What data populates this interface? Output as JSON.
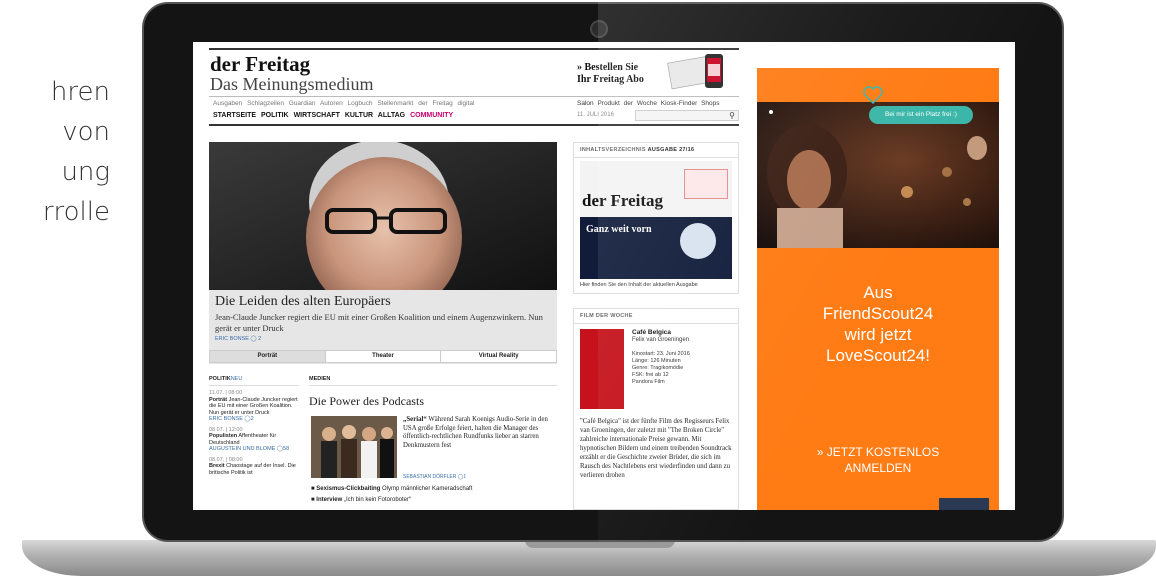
{
  "side_text": [
    "hren",
    "von",
    "ung",
    "rrolle"
  ],
  "header": {
    "logo": "der Freitag",
    "slogan": "Das Meinungsmedium",
    "abo_line1": "» Bestellen Sie",
    "abo_line2": "Ihr Freitag Abo",
    "subnav": [
      "Ausgaben",
      "Schlagzeilen",
      "Guardian",
      "Autoren",
      "Logbuch",
      "Stellenmarkt",
      "der Freitag digital"
    ],
    "subnav_right": [
      "Salon",
      "Produkt der Woche",
      "Kiosk-Finder",
      "Shops"
    ],
    "mainnav": [
      "STARTSEITE",
      "POLITIK",
      "WIRTSCHAFT",
      "KULTUR",
      "ALLTAG"
    ],
    "community": "COMMUNITY",
    "date": "11. JULI 2016",
    "search_placeholder": ""
  },
  "hero": {
    "title": "Die Leiden des alten Europäers",
    "subtitle": "Jean-Claude Juncker regiert die EU mit einer Großen Koalition und einem Augenzwinkern. Nun gerät er unter Druck",
    "author": "ERIC BONSE",
    "comments": "2",
    "tabs": [
      "Porträt",
      "Theater",
      "Virtual Reality"
    ]
  },
  "toc": {
    "head": "INHALTSVERZEICHNIS",
    "issue": "AUSGABE 27/16",
    "cover_logo": "der Freitag",
    "cover_text": "Ganz weit vorn",
    "caption": "Hier finden Sie den Inhalt der aktuellen Ausgabe"
  },
  "film": {
    "head": "FILM DER WOCHE",
    "title": "Café Belgica",
    "director": "Felix van Groeningen",
    "info": [
      "Kinostart: 23. Juni 2016",
      "Länge: 126 Minuten",
      "Genre: Tragikomödie",
      "FSK: frei ab 12",
      "Pandora Film"
    ],
    "text": "\"Café Belgica\" ist der fünfte Film des Regisseurs Felix van Groeningen, der zuletzt mit \"The Broken Circle\" zahlreiche internationale Preise gewann. Mit hypnotischen Bildern und einem treibenden Soundtrack erzählt er die Geschichte zweier Brüder, die sich im Rausch des Nachtlebens erst wiederfinden und dann zu verlieren drohen"
  },
  "politik": {
    "head": "POLITIK",
    "head_suffix": "NEU",
    "items": [
      {
        "time": "11.07. | 08:00",
        "title": "Porträt",
        "text": "Jean-Claude Juncker regiert die EU mit einer Großen Koalition. Nun gerät er unter Druck",
        "author": "ERIC BONSE",
        "comments": "2"
      },
      {
        "time": "08.07. | 12:00",
        "title": "Populisten",
        "text": "Affentheater für Deutschland",
        "author": "AUGUSTEIN UND BLOME",
        "comments": "58"
      },
      {
        "time": "08.07. | 08:00",
        "title": "Brexit",
        "text": "Chaostage auf der Insel. Die britische Politik ist",
        "author": "",
        "comments": ""
      }
    ]
  },
  "medien": {
    "head": "MEDIEN",
    "title": "Die Power des Podcasts",
    "text_bold": "„Serial“",
    "text": " Während Sarah Koenigs Audio-Serie in den USA große Erfolge feiert, halten die Manager des öffentlich-rechtlichen Rundfunks lieber an starren Denkmustern fest",
    "author": "SEBASTIAN DÖRFLER",
    "comments": "1",
    "list": [
      {
        "bold": "Sexismus-Clickbaiting",
        "text": " Olymp männlicher Kameradschaft"
      },
      {
        "bold": "Interview",
        "text": " „Ich bin kein Fotoroboter“"
      }
    ]
  },
  "ad": {
    "bubble": "Bei mir ist ein Platz frei :)",
    "title_lines": [
      "Aus",
      "FriendScout24",
      "wird jetzt",
      "LoveScout24!"
    ],
    "cta_lines": [
      "» JETZT KOSTENLOS",
      "ANMELDEN"
    ],
    "color": "#ff7b14"
  }
}
